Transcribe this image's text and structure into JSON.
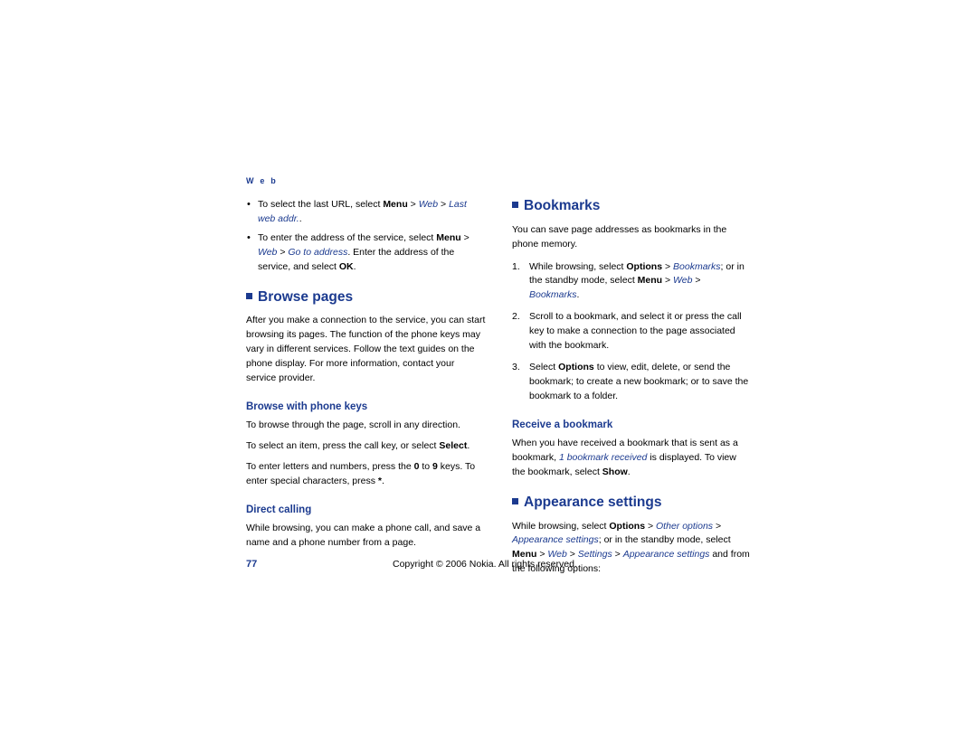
{
  "running_head": "W e b",
  "left_column": {
    "bullets": [
      "To select the last URL, select Menu > Web > Last web addr.",
      "To enter the address of the service, select Menu > Web > Go to address. Enter the address of the service, and select OK."
    ],
    "browse_pages": {
      "heading": "Browse pages",
      "body": "After you make a connection to the service, you can start browsing its pages. The function of the phone keys may vary in different services. Follow the text guides on the phone display. For more information, contact your service provider."
    },
    "browse_with_phone_keys": {
      "heading": "Browse with phone keys",
      "p1": "To browse through the page, scroll in any direction.",
      "p2": "To select an item, press the call key, or select Select.",
      "p3": "To enter letters and numbers, press the 0 to 9 keys. To enter special characters, press *."
    },
    "direct_calling": {
      "heading": "Direct calling",
      "body": "While browsing, you can make a phone call, and save a name and a phone number from a page."
    }
  },
  "right_column": {
    "bookmarks": {
      "heading": "Bookmarks",
      "intro": "You can save page addresses as bookmarks in the phone memory.",
      "steps": [
        "While browsing, select Options > Bookmarks; or in the standby mode, select Menu > Web > Bookmarks.",
        "Scroll to a bookmark, and select it or press the call key to make a connection to the page associated with the bookmark.",
        "Select Options to view, edit, delete, or send the bookmark; to create a new bookmark; or to save the bookmark to a folder."
      ]
    },
    "receive_a_bookmark": {
      "heading": "Receive a bookmark",
      "body": "When you have received a bookmark that is sent as a bookmark, 1 bookmark received is displayed. To view the bookmark, select Show."
    },
    "appearance_settings": {
      "heading": "Appearance settings",
      "body": "While browsing, select Options > Other options > Appearance settings; or in the standby mode, select Menu > Web > Settings > Appearance settings and from the following options:"
    }
  },
  "footer": {
    "page_number": "77",
    "copyright": "Copyright © 2006 Nokia. All rights reserved."
  },
  "colors": {
    "accent": "#1b3a8f",
    "text": "#000000",
    "background": "#ffffff"
  }
}
